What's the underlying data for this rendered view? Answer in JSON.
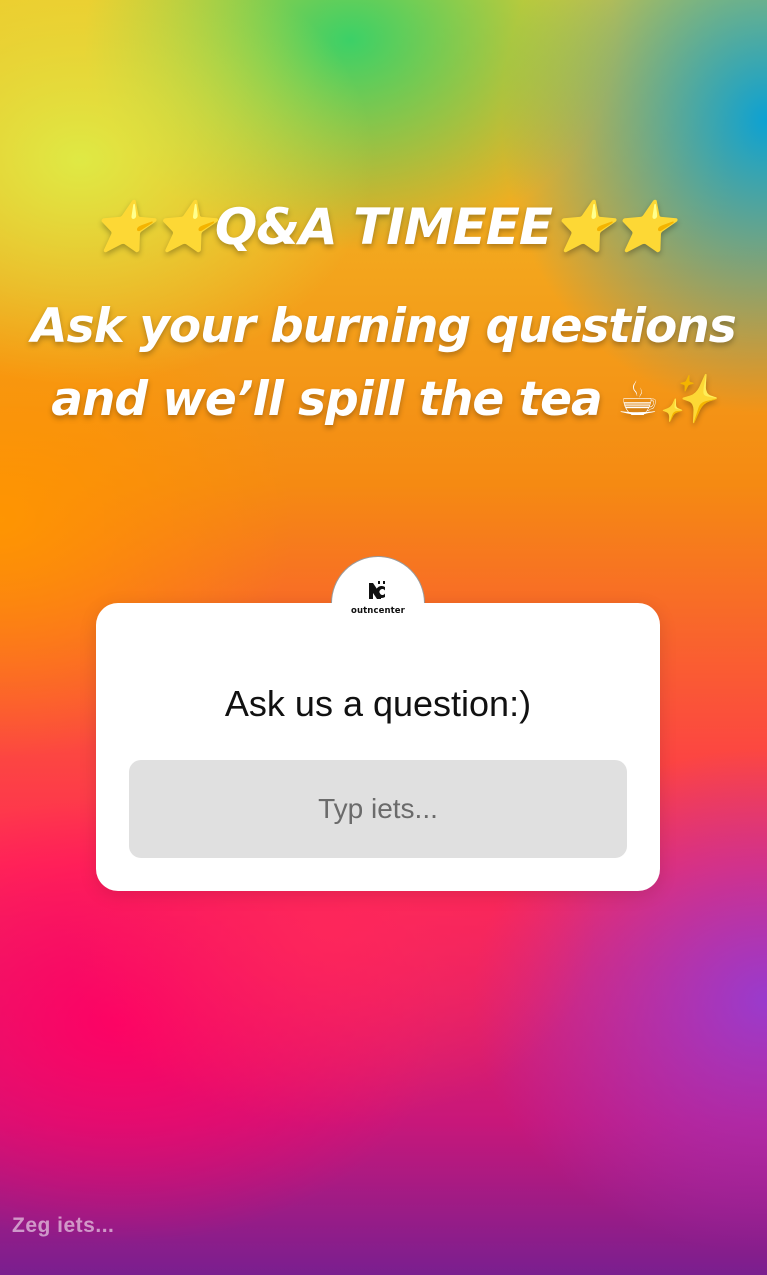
{
  "story": {
    "title": "⭐⭐Q&A TIMEEE⭐⭐",
    "subtitle": "Ask your burning questions and we’ll spill the tea ☕✨"
  },
  "question_sticker": {
    "account_name": "outncenter",
    "prompt": "Ask us a question:)",
    "answer_placeholder": "Typ iets..."
  },
  "reply_bar": {
    "placeholder": "Zeg iets..."
  },
  "colors": {
    "card_background": "#ffffff",
    "answer_box": "#e0e0e0",
    "prompt_text": "#111111"
  }
}
